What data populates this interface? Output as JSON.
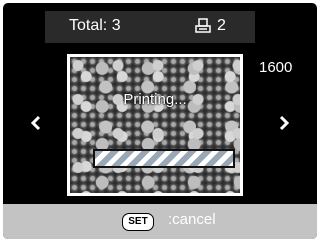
{
  "header": {
    "total_label": "Total: 3",
    "print_count": "2",
    "print_icon": "printer-icon"
  },
  "side_label": "1600",
  "navigation": {
    "left_icon": "chevron-left-icon",
    "right_icon": "chevron-right-icon"
  },
  "preview": {
    "status_text": "Printing...",
    "progress": 1.0
  },
  "footer": {
    "set_label": "SET",
    "cancel_label": ":cancel"
  },
  "colors": {
    "screen_bg": "#000000",
    "top_bar_bg": "#2a2a2a",
    "bottom_bar_bg": "#c3c3c3",
    "progress_stripe": "#9aa7b4"
  }
}
